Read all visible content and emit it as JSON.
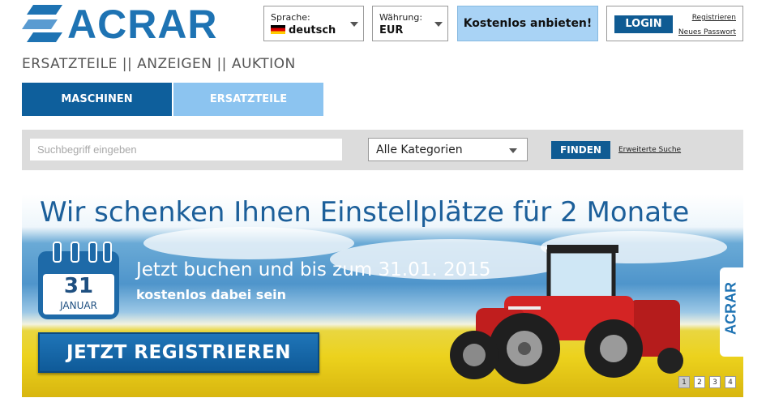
{
  "logo": {
    "text": "ACRAR"
  },
  "header": {
    "language": {
      "label": "Sprache:",
      "value": "deutsch"
    },
    "currency": {
      "label": "Währung:",
      "value": "EUR"
    },
    "offer_button": "Kostenlos anbieten!",
    "login_button": "LOGIN",
    "register_link": "Registrieren",
    "new_password_link": "Neues Passwort"
  },
  "nav": {
    "items": [
      "ERSATZTEILE",
      "ANZEIGEN",
      "AUKTION"
    ],
    "separator": "||"
  },
  "tabs": [
    {
      "label": "MASCHINEN",
      "active": true
    },
    {
      "label": "ERSATZTEILE",
      "active": false
    }
  ],
  "search": {
    "placeholder": "Suchbegriff eingeben",
    "category": "Alle Kategorien",
    "find_button": "FINDEN",
    "advanced_link": "Erweiterte Suche"
  },
  "banner": {
    "title": "Wir schenken Ihnen Einstellplätze für 2 Monate",
    "calendar_day": "31",
    "calendar_month": "JANUAR",
    "subtitle": "Jetzt buchen und bis zum 31.01. 2015",
    "subtitle2": "kostenlos dabei sein",
    "register_button": "JETZT REGISTRIEREN",
    "side_logo": "ACRAR",
    "pages": [
      "1",
      "2",
      "3",
      "4"
    ],
    "active_page": 1
  },
  "colors": {
    "brand_blue": "#1e73b3",
    "dark_button": "#0f5b93",
    "light_blue": "#a9d3f5"
  }
}
